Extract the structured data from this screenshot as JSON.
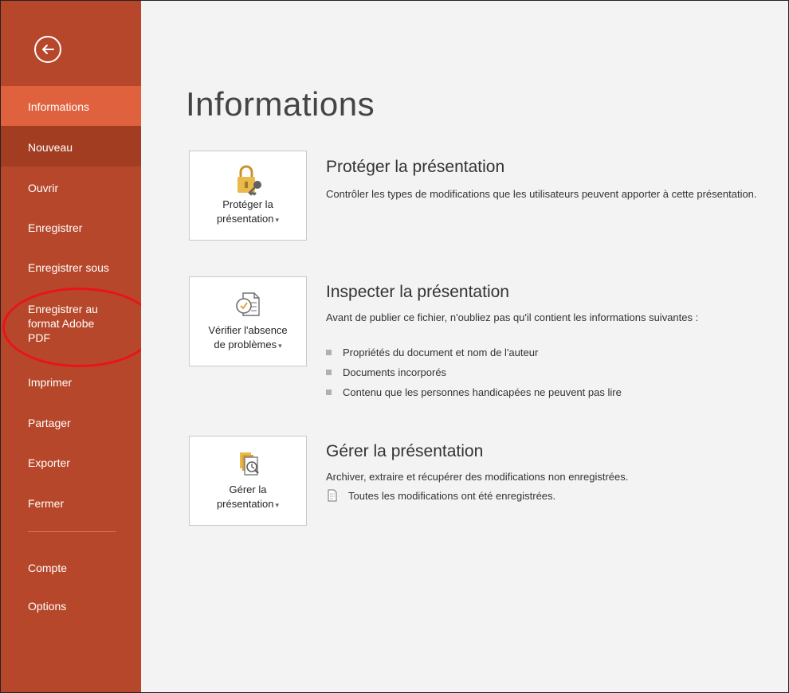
{
  "sidebar": {
    "back_icon": "back-arrow-icon",
    "items": [
      {
        "label": "Informations",
        "state": "active"
      },
      {
        "label": "Nouveau",
        "state": "hover"
      },
      {
        "label": "Ouvrir"
      },
      {
        "label": "Enregistrer"
      },
      {
        "label": "Enregistrer sous"
      },
      {
        "label": "Enregistrer au format Adobe PDF"
      },
      {
        "label": "Imprimer"
      },
      {
        "label": "Partager"
      },
      {
        "label": "Exporter"
      },
      {
        "label": "Fermer"
      },
      {
        "label": "Compte"
      },
      {
        "label": "Options"
      }
    ]
  },
  "main": {
    "title": "Informations",
    "protect": {
      "card_label_1": "Protéger la",
      "card_label_2": "présentation",
      "title": "Protéger la présentation",
      "description": "Contrôler les types de modifications que les utilisateurs peuvent apporter à cette présentation.",
      "icon": "lock-key-icon"
    },
    "inspect": {
      "card_label_1": "Vérifier l'absence",
      "card_label_2": "de problèmes",
      "title": "Inspecter la présentation",
      "description": "Avant de publier ce fichier, n'oubliez pas qu'il contient les informations suivantes :",
      "bullets": [
        "Propriétés du document et nom de l'auteur",
        "Documents incorporés",
        "Contenu que les personnes handicapées ne peuvent pas lire"
      ],
      "icon": "inspect-document-icon"
    },
    "manage": {
      "card_label_1": "Gérer la",
      "card_label_2": "présentation",
      "title": "Gérer la présentation",
      "description": "Archiver, extraire et récupérer des modifications non enregistrées.",
      "status": "Toutes les modifications ont été enregistrées.",
      "icon": "manage-versions-icon"
    }
  },
  "colors": {
    "sidebar": "#b7472a",
    "active_item": "#e0613e",
    "annotation_oval": "#e8141c"
  }
}
